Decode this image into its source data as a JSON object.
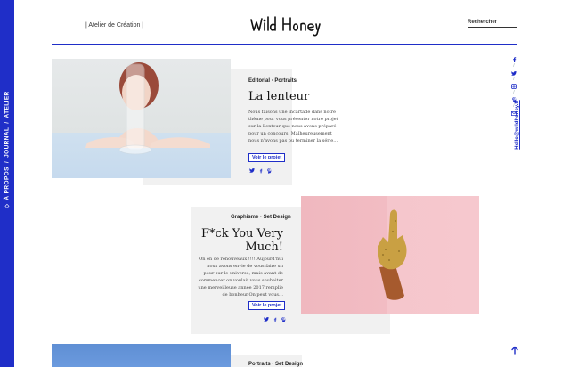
{
  "nav": {
    "items": [
      "Atelier",
      "Journal",
      "À propos"
    ],
    "separators": [
      "/",
      "/"
    ],
    "marker": "◇"
  },
  "header": {
    "tagline": "| Atelier de Création |",
    "logo": "Wild Honey",
    "search_placeholder": "Rechercher"
  },
  "social": {
    "icons": [
      "facebook-icon",
      "twitter-icon",
      "instagram-icon",
      "pinterest-icon",
      "email-icon"
    ],
    "email": "Hello@wildhoney.fr"
  },
  "cards": [
    {
      "category": "Editorial · Portraits",
      "title": "La lenteur",
      "excerpt": "Nous faisons une incartade dans notre thème pour vous présenter notre projet sur la Lenteur que nous avons préparé pour un concours. Malheureusement nous n'avons pas pu terminer la série…",
      "button": "Voir le projet",
      "shares": [
        "𝕥",
        "f",
        "𝓅"
      ]
    },
    {
      "category": "Graphisme · Set Design",
      "title": "F*ck You Very Much!",
      "excerpt": "On en de renouveaux !!!! Aujourd'hui nous avons envie de vous faire un pour sur le universe, mais avant de commencer on voulait vous souhaiter une merveilleuse année 2017 remplie de bonheur.On peut vous…",
      "button": "Voir le projet",
      "shares": [
        "𝕥",
        "f",
        "𝓅"
      ]
    },
    {
      "category": "Portraits · Set Design"
    }
  ],
  "colors": {
    "accent": "#1f2ec8",
    "panel": "#f1f1f1"
  }
}
